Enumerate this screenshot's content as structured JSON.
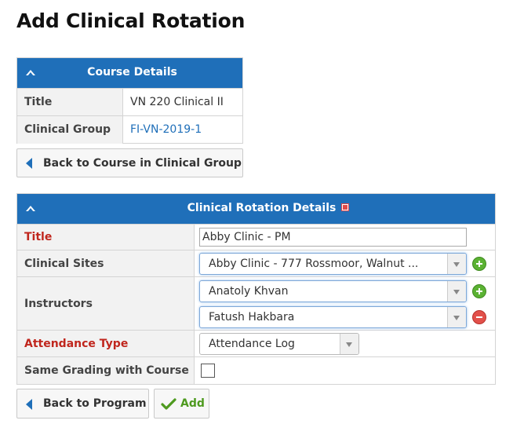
{
  "page": {
    "title": "Add Clinical Rotation"
  },
  "course_details": {
    "header": "Course Details",
    "rows": [
      {
        "label": "Title",
        "value": "VN 220 Clinical II"
      },
      {
        "label": "Clinical Group",
        "value": "FI-VN-2019-1"
      }
    ],
    "back_button": "Back to Course in Clinical Group"
  },
  "rotation_details": {
    "header": "Clinical Rotation Details",
    "title_label": "Title",
    "title_value": "Abby Clinic - PM",
    "sites_label": "Clinical Sites",
    "sites_selected": "Abby Clinic - 777 Rossmoor, Walnut ...",
    "instructors_label": "Instructors",
    "instructors": [
      "Anatoly Khvan",
      "Fatush Hakbara"
    ],
    "attendance_label": "Attendance Type",
    "attendance_selected": "Attendance Log",
    "grading_label": "Same Grading with Course",
    "grading_checked": false
  },
  "actions": {
    "back_to_program": "Back to Program",
    "add": "Add"
  },
  "colors": {
    "header_blue": "#1f6fb9",
    "required_red": "#c0261d",
    "add_green": "#4e9a1f"
  }
}
